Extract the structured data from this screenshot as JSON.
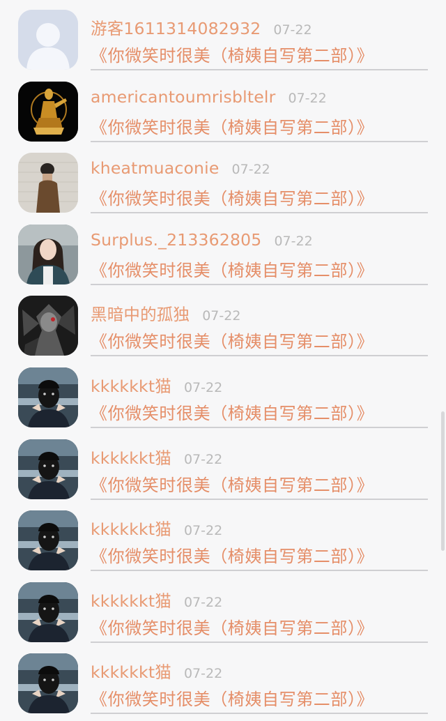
{
  "comments": [
    {
      "user": "游客1611314082932",
      "time": "07-22",
      "book": "《你微笑时很美（椅姨自写第二部）》",
      "avatar": "default-avatar-icon"
    },
    {
      "user": "americantoumrisbltelr",
      "time": "07-22",
      "book": "《你微笑时很美（椅姨自写第二部）》",
      "avatar": "golden-statue-avatar"
    },
    {
      "user": "kheatmuaconie",
      "time": "07-22",
      "book": "《你微笑时很美（椅姨自写第二部）》",
      "avatar": "person-wall-avatar"
    },
    {
      "user": "Surplus._213362805",
      "time": "07-22",
      "book": "《你微笑时很美（椅姨自写第二部）》",
      "avatar": "girl-street-avatar"
    },
    {
      "user": "黑暗中的孤独",
      "time": "07-22",
      "book": "《你微笑时很美（椅姨自写第二部）》",
      "avatar": "dark-anime-avatar"
    },
    {
      "user": "kkkkkkt猫",
      "time": "07-22",
      "book": "《你微笑时很美（椅姨自写第二部）》",
      "avatar": "masked-man-avatar"
    },
    {
      "user": "kkkkkkt猫",
      "time": "07-22",
      "book": "《你微笑时很美（椅姨自写第二部）》",
      "avatar": "masked-man-avatar"
    },
    {
      "user": "kkkkkkt猫",
      "time": "07-22",
      "book": "《你微笑时很美（椅姨自写第二部）》",
      "avatar": "masked-man-avatar"
    },
    {
      "user": "kkkkkkt猫",
      "time": "07-22",
      "book": "《你微笑时很美（椅姨自写第二部）》",
      "avatar": "masked-man-avatar"
    },
    {
      "user": "kkkkkkt猫",
      "time": "07-22",
      "book": "《你微笑时很美（椅姨自写第二部）》",
      "avatar": "masked-man-avatar"
    }
  ],
  "colors": {
    "username": "#e89a73",
    "book_title": "#e58e68",
    "time": "#b9b9b9",
    "divider": "#cfcfd2",
    "background": "#f7f7f8"
  }
}
